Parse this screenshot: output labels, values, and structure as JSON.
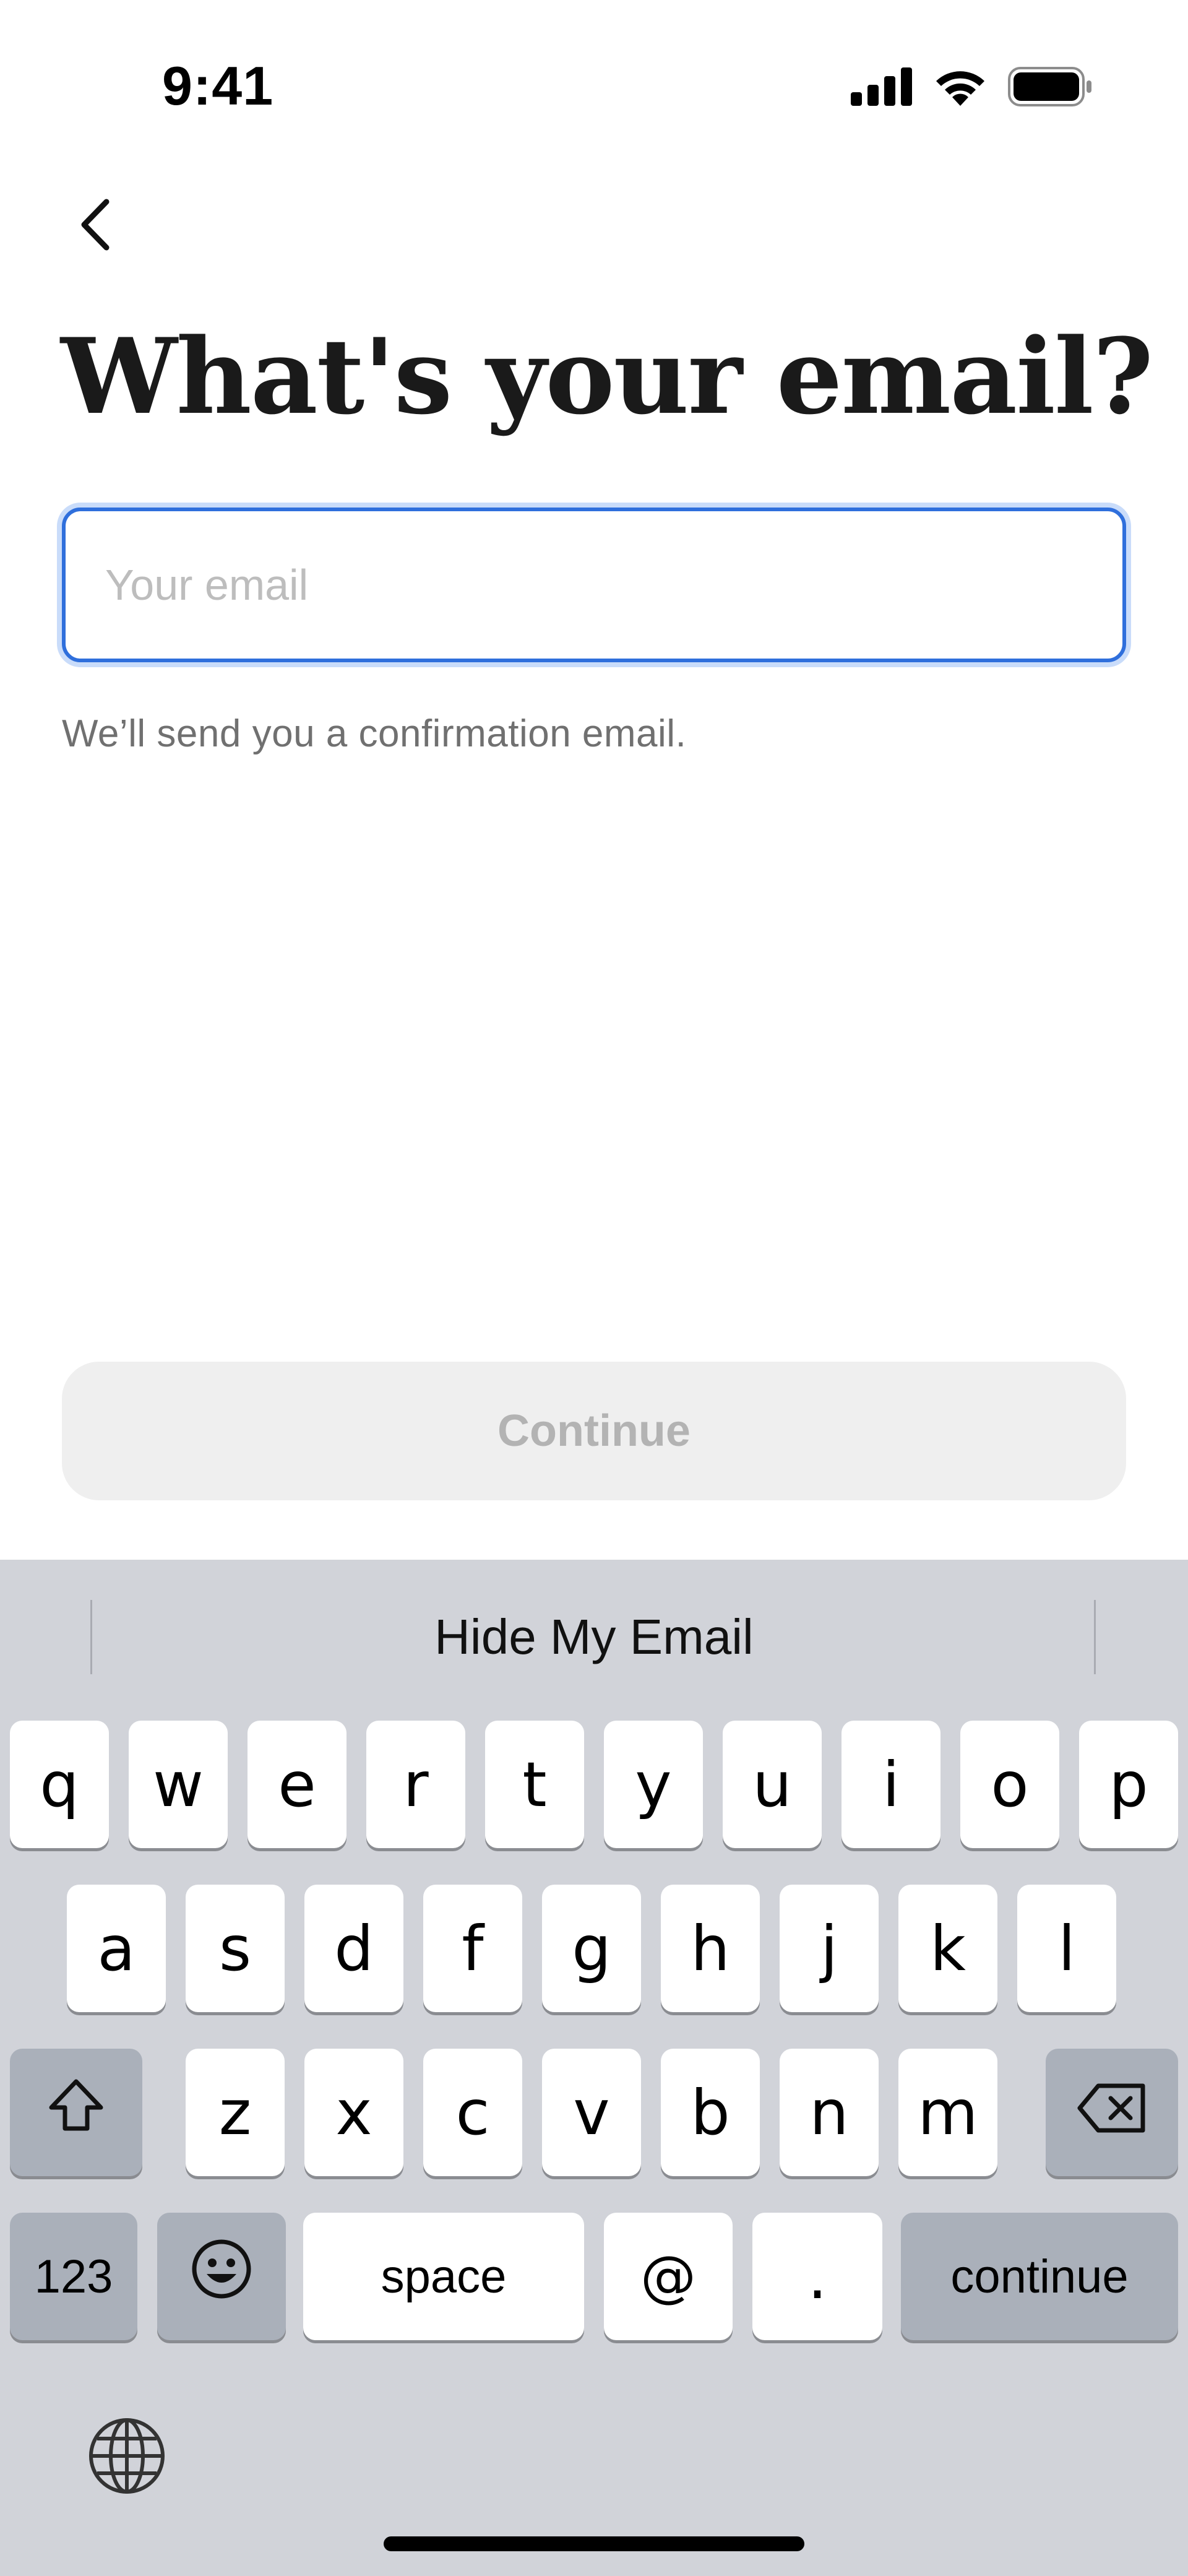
{
  "status_bar": {
    "time": "9:41",
    "icons": [
      "signal-icon",
      "wifi-icon",
      "battery-icon"
    ]
  },
  "header": {
    "back_icon": "chevron-left-icon",
    "title": "What's your email?"
  },
  "form": {
    "email_value": "",
    "email_placeholder": "Your email",
    "helper_text": "We’ll send you a confirmation email.",
    "continue_label": "Continue",
    "continue_enabled": false
  },
  "keyboard": {
    "suggestion": "Hide My Email",
    "row1": [
      "q",
      "w",
      "e",
      "r",
      "t",
      "y",
      "u",
      "i",
      "o",
      "p"
    ],
    "row2": [
      "a",
      "s",
      "d",
      "f",
      "g",
      "h",
      "j",
      "k",
      "l"
    ],
    "row3": [
      "z",
      "x",
      "c",
      "v",
      "b",
      "n",
      "m"
    ],
    "numbers_label": "123",
    "space_label": "space",
    "at_label": "@",
    "dot_label": ".",
    "return_label": "continue",
    "icons": [
      "shift-icon",
      "backspace-icon",
      "emoji-icon",
      "globe-icon"
    ]
  },
  "colors": {
    "focus_border": "#2f6fdc",
    "focus_glow": "#c9dcfa",
    "keyboard_bg": "#d1d3d9",
    "dark_key": "#aab0ba",
    "disabled_button_bg": "#efefef",
    "disabled_button_text": "#b3b3b3"
  }
}
